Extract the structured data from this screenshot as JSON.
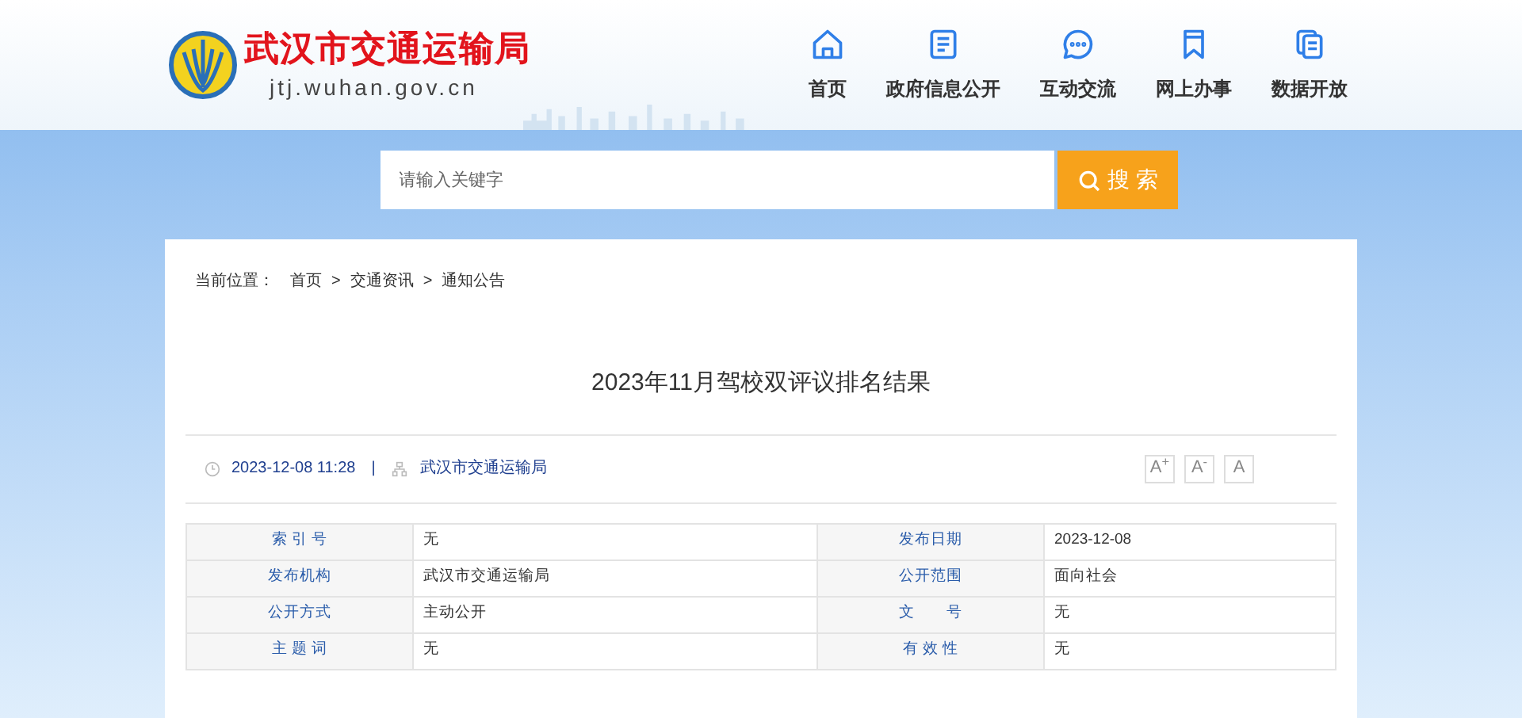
{
  "header": {
    "site_name": "武汉市交通运输局",
    "domain": "jtj.wuhan.gov.cn",
    "nav": [
      {
        "label": "首页",
        "kind": "home"
      },
      {
        "label": "政府信息公开",
        "kind": "doc"
      },
      {
        "label": "互动交流",
        "kind": "chat"
      },
      {
        "label": "网上办事",
        "kind": "bookmark"
      },
      {
        "label": "数据开放",
        "kind": "files"
      }
    ]
  },
  "search": {
    "placeholder": "请输入关键字",
    "button": "搜 索"
  },
  "breadcrumb": {
    "prefix": "当前位置：",
    "items": [
      "首页",
      "交通资讯",
      "通知公告"
    ],
    "separator": ">"
  },
  "article": {
    "title": "2023年11月驾校双评议排名结果",
    "date": "2023-12-08 11:28",
    "divider": "|",
    "source": "武汉市交通运输局",
    "font_buttons": [
      "A$^{+}$",
      "A$^{-}$",
      "A"
    ]
  },
  "info_table": {
    "rows": [
      [
        {
          "label": "索 引 号",
          "value": "无"
        },
        {
          "label": "发布日期",
          "value": "2023-12-08"
        }
      ],
      [
        {
          "label": "发布机构",
          "value": "武汉市交通运输局"
        },
        {
          "label": "公开范围",
          "value": "面向社会"
        }
      ],
      [
        {
          "label": "公开方式",
          "value": "主动公开"
        },
        {
          "label": "文　　号",
          "value": "无"
        }
      ],
      [
        {
          "label": "主 题 词",
          "value": "无"
        },
        {
          "label": "有 效 性",
          "value": "无"
        }
      ]
    ]
  }
}
